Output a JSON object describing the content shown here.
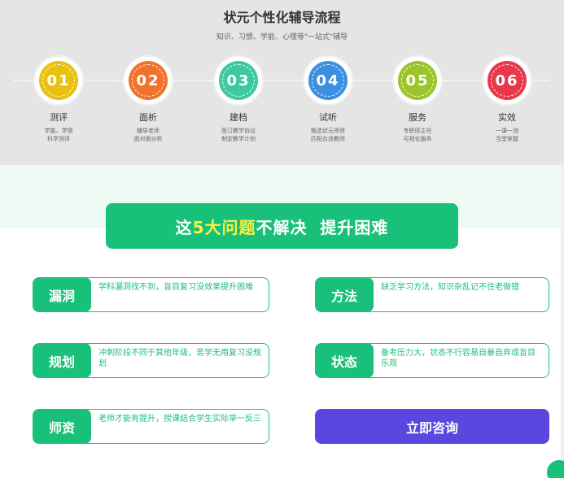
{
  "process": {
    "title": "状元个性化辅导流程",
    "subtitle": "知识、习惯、学能、心理等\"一站式\"辅导",
    "steps": [
      {
        "num": "01",
        "name": "测评",
        "desc1": "学能、学情",
        "desc2": "科学测评",
        "color": "#e8c20f"
      },
      {
        "num": "02",
        "name": "面析",
        "desc1": "辅导老师",
        "desc2": "面对面分析",
        "color": "#f0732d"
      },
      {
        "num": "03",
        "name": "建档",
        "desc1": "签订教学协议",
        "desc2": "制定教学计划",
        "color": "#3cc9a0"
      },
      {
        "num": "04",
        "name": "试听",
        "desc1": "甄选状元师资",
        "desc2": "匹配合适教师",
        "color": "#3d8fe0"
      },
      {
        "num": "05",
        "name": "服务",
        "desc1": "专职班主任",
        "desc2": "可视化服务",
        "color": "#9bc52a"
      },
      {
        "num": "06",
        "name": "实效",
        "desc1": "一课一测",
        "desc2": "当堂掌握",
        "color": "#e8384a"
      }
    ]
  },
  "banner": {
    "prefix": "这",
    "highlight": "5大问题",
    "suffix": "不解决  提升困难"
  },
  "problems": [
    {
      "tag": "漏洞",
      "text": "学科漏洞找不到，盲目复习没效果提升困难"
    },
    {
      "tag": "方法",
      "text": "缺乏学习方法，知识杂乱记不住老做错"
    },
    {
      "tag": "规划",
      "text": "冲刺阶段不同于其他年级，苦学无用复习没规划"
    },
    {
      "tag": "状态",
      "text": "备考压力大，状态不行容易自暴自弃或盲目乐观"
    },
    {
      "tag": "师资",
      "text": "老师才能有提升，授课结合学生实际举一反三"
    }
  ],
  "consult_label": "立即咨询"
}
